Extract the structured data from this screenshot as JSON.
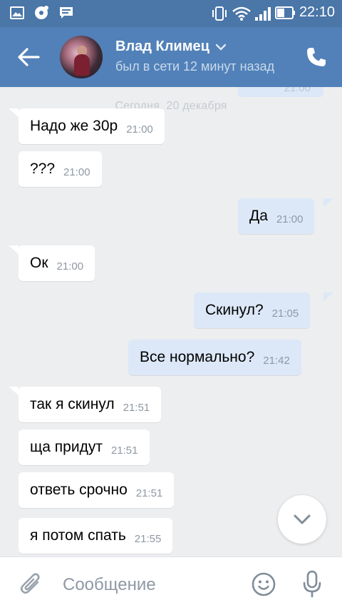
{
  "statusbar": {
    "time": "22:10",
    "icons": [
      "gallery-icon",
      "media-icon",
      "chat-notification-icon",
      "vibrate-icon",
      "wifi-icon",
      "signal-icon",
      "battery-icon"
    ]
  },
  "header": {
    "name": "Влад Климец",
    "status": "был в сети 12 минут назад",
    "accent": "#5181b8"
  },
  "chat": {
    "date_separator": "Сегодня, 20 декабря",
    "partial_time": "21:00",
    "messages": [
      {
        "dir": "in",
        "text": "Надо же 30р",
        "time": "21:00"
      },
      {
        "dir": "in",
        "text": "???",
        "time": "21:00"
      },
      {
        "dir": "out",
        "text": "Да",
        "time": "21:00"
      },
      {
        "dir": "in",
        "text": "Ок",
        "time": "21:00"
      },
      {
        "dir": "out",
        "text": "Скинул?",
        "time": "21:05"
      },
      {
        "dir": "out",
        "text": "Все нормально?",
        "time": "21:42"
      },
      {
        "dir": "in",
        "text": "так я скинул",
        "time": "21:51"
      },
      {
        "dir": "in",
        "text": "ща придут",
        "time": "21:51"
      },
      {
        "dir": "in",
        "text": "ответь срочно",
        "time": "21:51"
      },
      {
        "dir": "in",
        "text": "я потом спать",
        "time": "21:55"
      }
    ]
  },
  "compose": {
    "placeholder": "Сообщение"
  }
}
